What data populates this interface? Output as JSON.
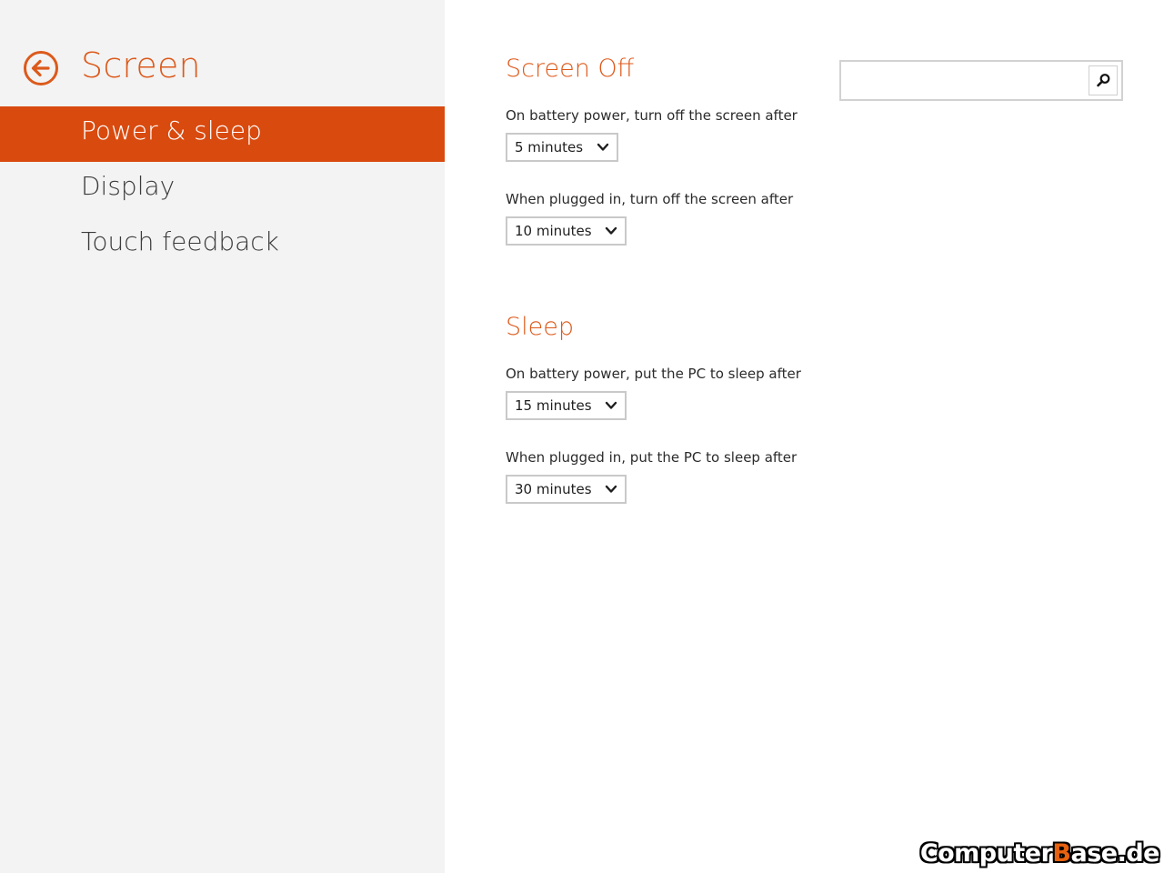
{
  "colors": {
    "accent": "#dc5a1b",
    "selected_bg": "#d94a0f",
    "sidebar_bg": "#f3f3f3",
    "content_bg": "#ffffff"
  },
  "sidebar": {
    "back_icon": "back-arrow-circle-icon",
    "title": "Screen",
    "items": [
      {
        "label": "Power & sleep",
        "selected": true
      },
      {
        "label": "Display",
        "selected": false
      },
      {
        "label": "Touch feedback",
        "selected": false
      }
    ]
  },
  "search": {
    "placeholder": "",
    "value": "",
    "icon": "search-icon"
  },
  "screen_off": {
    "title": "Screen Off",
    "battery_label": "On battery power, turn off the screen after",
    "battery_value": "5 minutes",
    "plugged_label": "When plugged in, turn off the screen after",
    "plugged_value": "10 minutes"
  },
  "sleep": {
    "title": "Sleep",
    "battery_label": "On battery power, put the PC to sleep after",
    "battery_value": "15 minutes",
    "plugged_label": "When plugged in, put the PC to sleep after",
    "plugged_value": "30 minutes"
  },
  "watermark": {
    "part1": "Computer",
    "part2": "B",
    "part3": "ase.de"
  }
}
